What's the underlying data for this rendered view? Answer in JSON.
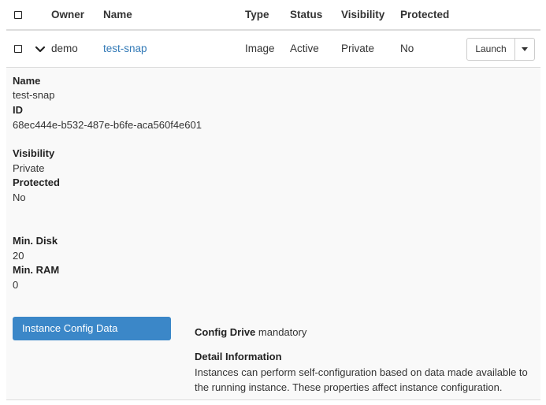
{
  "header": {
    "owner": "Owner",
    "name": "Name",
    "type": "Type",
    "status": "Status",
    "visibility": "Visibility",
    "protected": "Protected"
  },
  "row": {
    "owner": "demo",
    "name": "test-snap",
    "type": "Image",
    "status": "Active",
    "visibility": "Private",
    "protected": "No",
    "launch_label": "Launch"
  },
  "detail": {
    "name_label": "Name",
    "name_value": "test-snap",
    "id_label": "ID",
    "id_value": "68ec444e-b532-487e-b6fe-aca560f4e601",
    "visibility_label": "Visibility",
    "visibility_value": "Private",
    "protected_label": "Protected",
    "protected_value": "No",
    "min_disk_label": "Min. Disk",
    "min_disk_value": "20",
    "min_ram_label": "Min. RAM",
    "min_ram_value": "0",
    "config_button_label": "Instance Config Data",
    "config_drive_label": "Config Drive",
    "config_drive_value": "mandatory",
    "detail_info_label": "Detail Information",
    "detail_info_text": "Instances can perform self-configuration based on data made available to the running instance. These properties affect instance configuration."
  },
  "colors": {
    "link": "#337ab7",
    "primary_button": "#3b87c8"
  }
}
